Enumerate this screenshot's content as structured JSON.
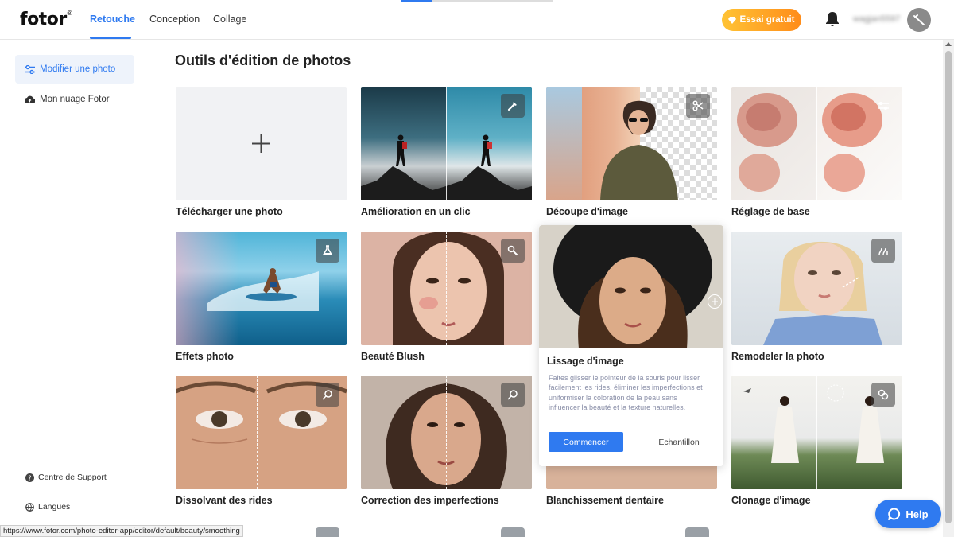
{
  "header": {
    "logo": "fotor",
    "logo_mark": "®",
    "tabs": [
      "Retouche",
      "Conception",
      "Collage"
    ],
    "trial_button": "Essai gratuit",
    "username": "wagjan5597"
  },
  "sidebar": {
    "items": [
      "Modifier une photo",
      "Mon nuage Fotor"
    ],
    "bottom": [
      "Centre de Support",
      "Langues"
    ]
  },
  "main": {
    "title": "Outils d'édition de photos",
    "cards": [
      "Télécharger une photo",
      "Amélioration en un clic",
      "Découpe d'image",
      "Réglage de base",
      "Effets photo",
      "Beauté Blush",
      "Remodeler la photo",
      "Dissolvant des rides",
      "Correction des imperfections",
      "Blanchissement dentaire",
      "Clonage d'image"
    ]
  },
  "popup": {
    "title": "Lissage d'image",
    "description": "Faites glisser le pointeur de la souris pour lisser facilement les rides, éliminer les imperfections et uniformiser la coloration de la peau sans influencer la beauté et la texture naturelles.",
    "start_button": "Commencer",
    "sample_button": "Echantillon"
  },
  "help_button": "Help",
  "status_url": "https://www.fotor.com/photo-editor-app/editor/default/beauty/smoothing",
  "colors": {
    "accent": "#2f7af0",
    "trial_start": "#ffc334",
    "trial_end": "#ff8c1a"
  }
}
